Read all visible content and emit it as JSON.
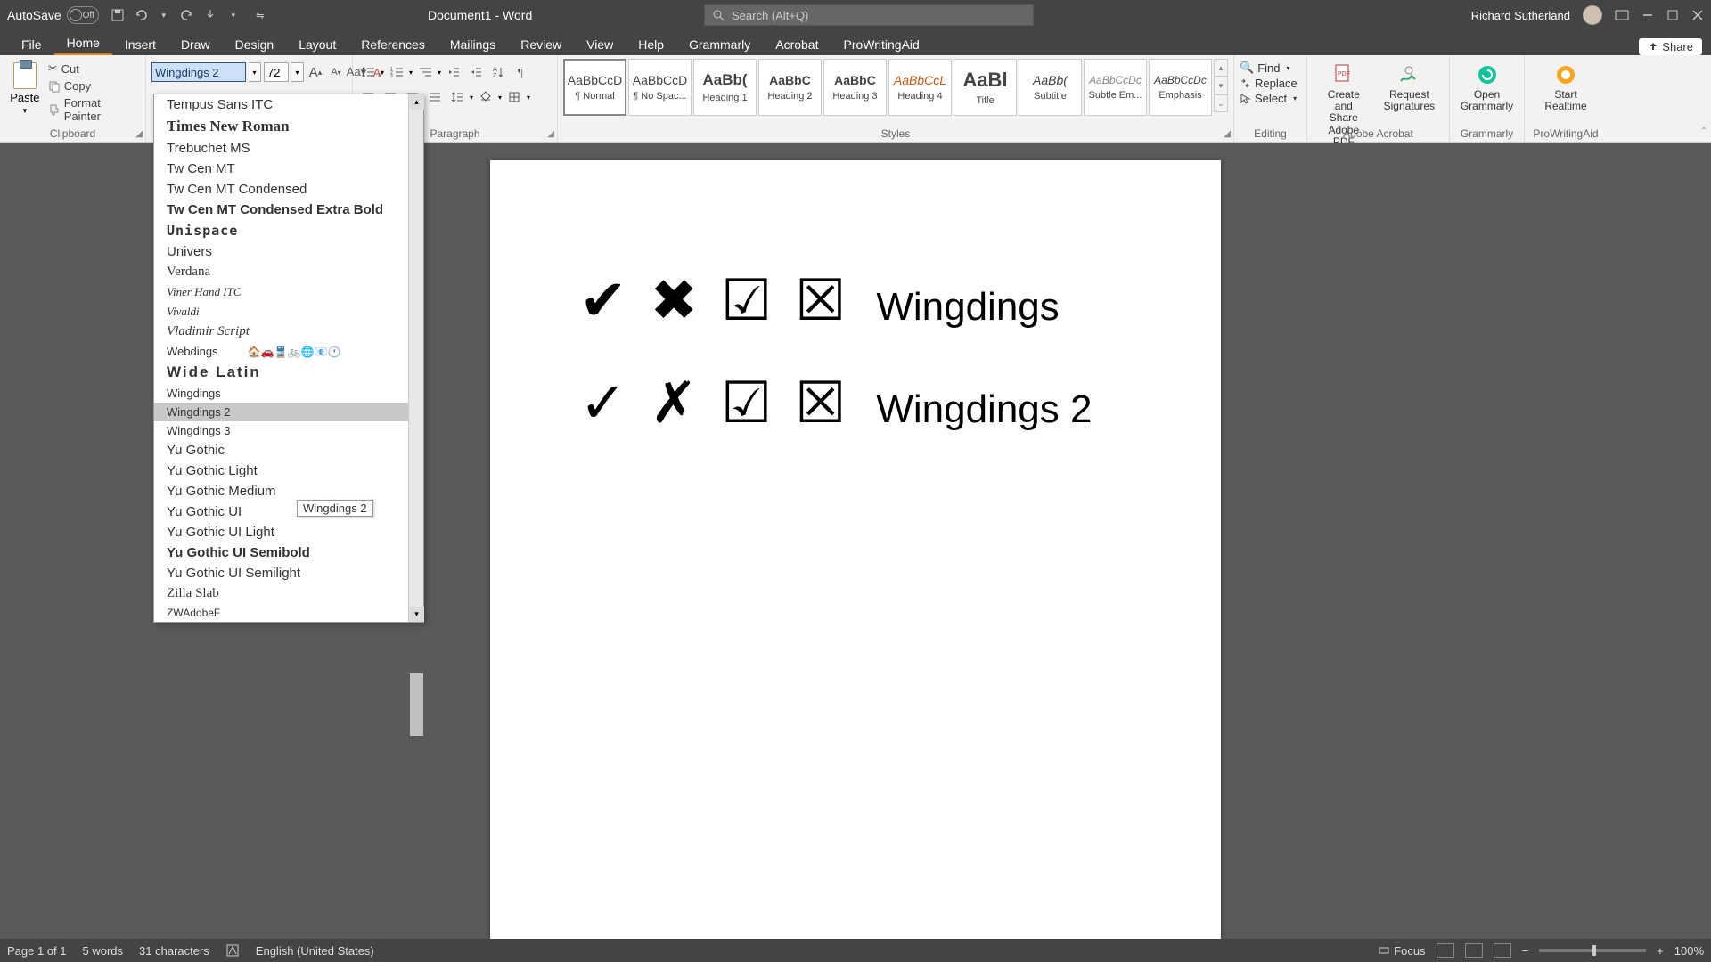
{
  "titlebar": {
    "autosave_label": "AutoSave",
    "autosave_state": "Off",
    "document_title": "Document1  -  Word",
    "search_placeholder": "Search (Alt+Q)",
    "user_name": "Richard Sutherland"
  },
  "tabs": [
    "File",
    "Home",
    "Insert",
    "Draw",
    "Design",
    "Layout",
    "References",
    "Mailings",
    "Review",
    "View",
    "Help",
    "Grammarly",
    "Acrobat",
    "ProWritingAid"
  ],
  "active_tab": "Home",
  "share_label": "Share",
  "ribbon": {
    "clipboard": {
      "label": "Clipboard",
      "paste": "Paste",
      "cut": "Cut",
      "copy": "Copy",
      "fp": "Format Painter"
    },
    "font": {
      "name_value": "Wingdings 2",
      "size_value": "72"
    },
    "paragraph": {
      "label": "Paragraph"
    },
    "styles": {
      "label": "Styles",
      "items": [
        {
          "preview": "AaBbCcD",
          "name": "¶ Normal"
        },
        {
          "preview": "AaBbCcD",
          "name": "¶ No Spac..."
        },
        {
          "preview": "AaBb(",
          "name": "Heading 1"
        },
        {
          "preview": "AaBbC",
          "name": "Heading 2"
        },
        {
          "preview": "AaBbC",
          "name": "Heading 3"
        },
        {
          "preview": "AaBbCcL",
          "name": "Heading 4"
        },
        {
          "preview": "AaBl",
          "name": "Title"
        },
        {
          "preview": "AaBb(",
          "name": "Subtitle"
        },
        {
          "preview": "AaBbCcDc",
          "name": "Subtle Em..."
        },
        {
          "preview": "AaBbCcDc",
          "name": "Emphasis"
        }
      ]
    },
    "editing": {
      "label": "Editing",
      "find": "Find",
      "replace": "Replace",
      "select": "Select"
    },
    "adobe": {
      "label": "Adobe Acrobat",
      "btn1": "Create and Share\nAdobe PDF",
      "btn2": "Request\nSignatures"
    },
    "grammarly": {
      "label": "Grammarly",
      "btn": "Open\nGrammarly"
    },
    "pwa": {
      "label": "ProWritingAid",
      "btn": "Start\nRealtime"
    }
  },
  "font_dropdown": {
    "items": [
      "Tempus Sans ITC",
      "Times New Roman",
      "Trebuchet MS",
      "Tw Cen MT",
      "Tw Cen MT Condensed",
      "Tw Cen MT Condensed Extra Bold",
      "Unispace",
      "Univers",
      "Verdana",
      "Viner Hand ITC",
      "Vivaldi",
      "Vladimir Script",
      "Webdings",
      "Wide Latin",
      "Wingdings",
      "Wingdings 2",
      "Wingdings 3",
      "Yu Gothic",
      "Yu Gothic Light",
      "Yu Gothic Medium",
      "Yu Gothic UI",
      "Yu Gothic UI Light",
      "Yu Gothic UI Semibold",
      "Yu Gothic UI Semilight",
      "Zilla Slab",
      "ZWAdobeF"
    ],
    "highlighted_index": 15,
    "tooltip": "Wingdings 2"
  },
  "document": {
    "line1_glyphs": "✔ ✖ ☑ ☒",
    "line1_label": "Wingdings",
    "line2_glyphs": "✓ ✗ ☑ ☒",
    "line2_label": "Wingdings 2"
  },
  "statusbar": {
    "page": "Page 1 of 1",
    "words": "5 words",
    "chars": "31 characters",
    "lang": "English (United States)",
    "focus": "Focus",
    "zoom": "100%"
  }
}
